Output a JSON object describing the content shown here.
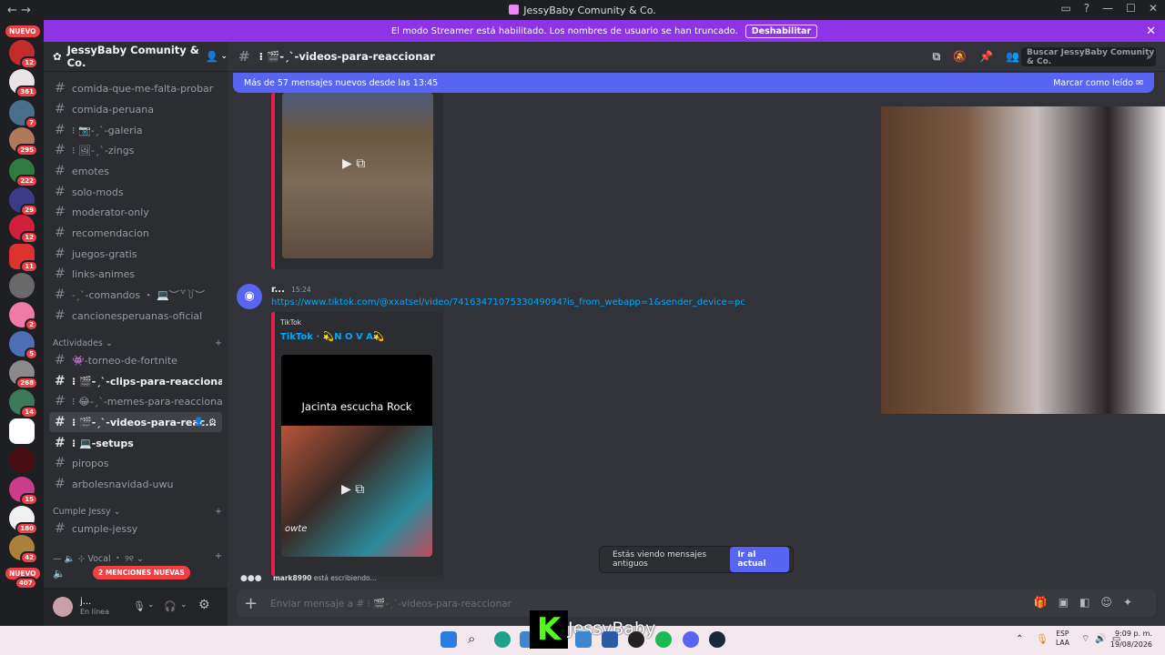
{
  "window": {
    "title": "JessyBaby Comunity & Co.",
    "nav": "← →"
  },
  "banner": {
    "text": "El modo Streamer está habilitado. Los nombres de usuario se han truncado.",
    "button": "Deshabilitar"
  },
  "servers": {
    "new_top": "NUEVO",
    "new_bottom": "NUEVO",
    "badges": [
      "12",
      "361",
      "7",
      "295",
      "222",
      "29",
      "12",
      "11",
      "2",
      "5",
      "268",
      "14",
      "",
      "",
      "15",
      "180",
      "42",
      "407"
    ]
  },
  "server": {
    "name": "JessyBaby Comunity & Co."
  },
  "channels": [
    {
      "name": "comida-que-me-falta-probar",
      "unread": false
    },
    {
      "name": "comida-peruana",
      "unread": false
    },
    {
      "name": "⁝ 📷-ˏˋ-galeria",
      "unread": false
    },
    {
      "name": "⁝ 🖼-ˏˋ-zings",
      "unread": false
    },
    {
      "name": "emotes",
      "unread": false
    },
    {
      "name": "solo-mods",
      "unread": false
    },
    {
      "name": "moderator-only",
      "unread": false
    },
    {
      "name": "recomendacion",
      "unread": false
    },
    {
      "name": "juegos-gratis",
      "unread": false
    },
    {
      "name": "links-animes",
      "unread": false
    },
    {
      "name": "˗ˏˋ-comandos ・ 💻︶꒷꒦︶",
      "unread": false
    },
    {
      "name": "cancionesperuanas-oficial",
      "unread": false
    }
  ],
  "cat_actividades": "Actividades",
  "channels2": [
    {
      "name": "👾-torneo-de-fortnite",
      "unread": false
    },
    {
      "name": "⁝ 🎬-ˏˋ-clips-para-reaccionar",
      "unread": true
    },
    {
      "name": "⁝ 😂-ˏˋ-memes-para-reaccionar",
      "unread": false
    },
    {
      "name": "⁝ 🎬-ˏˋ-videos-para-reac...",
      "unread": true,
      "selected": true
    },
    {
      "name": "⁝ 💻-setups",
      "unread": true
    },
    {
      "name": "piropos",
      "unread": false
    },
    {
      "name": "arbolesnavidad-uwu",
      "unread": false
    }
  ],
  "cat_cumple": "Cumple Jessy",
  "channels3": [
    {
      "name": "cumple-jessy"
    }
  ],
  "cat_vocal": "⊹ Vocal ・ ୨୧",
  "mentions": "2 MENCIONES NUEVAS",
  "user": {
    "name": "j...",
    "status": "En línea"
  },
  "channel_header": "⁝ 🎬-ˏˋ-videos-para-reaccionar",
  "search_placeholder": "Buscar JessyBaby Comunity & Co.",
  "newbar": {
    "text": "Más de 57 mensajes nuevos desde las 13:45",
    "action": "Marcar como leído"
  },
  "message": {
    "author": "r...",
    "time": "15:24",
    "link": "https://www.tiktok.com/@xxatsel/video/7416347107533049094?is_from_webapp=1&sender_device=pc",
    "provider": "TikTok",
    "embed_title": "TikTok · 💫N O V A💫",
    "video_text": "Jacinta escucha Rock",
    "video_overlay": "owte"
  },
  "old_messages": {
    "text": "Estás viendo mensajes antiguos",
    "button": "Ir al actual"
  },
  "typing": {
    "user": "mark8990",
    "text": "está escribiendo..."
  },
  "composer": {
    "placeholder": "Enviar mensaje a # ⁝ 🎬-ˏˋ-videos-para-reaccionar"
  },
  "overlay": {
    "name": "JessyBaby",
    "logo": "K"
  },
  "taskbar": {
    "lang1": "ESP",
    "lang2": "LAA",
    "time": "9:09 p. m.",
    "date": "19/08/2026"
  },
  "colors": {
    "accent": "#5865f2",
    "banner": "#8e34e6",
    "embed": "#e61e4d"
  }
}
